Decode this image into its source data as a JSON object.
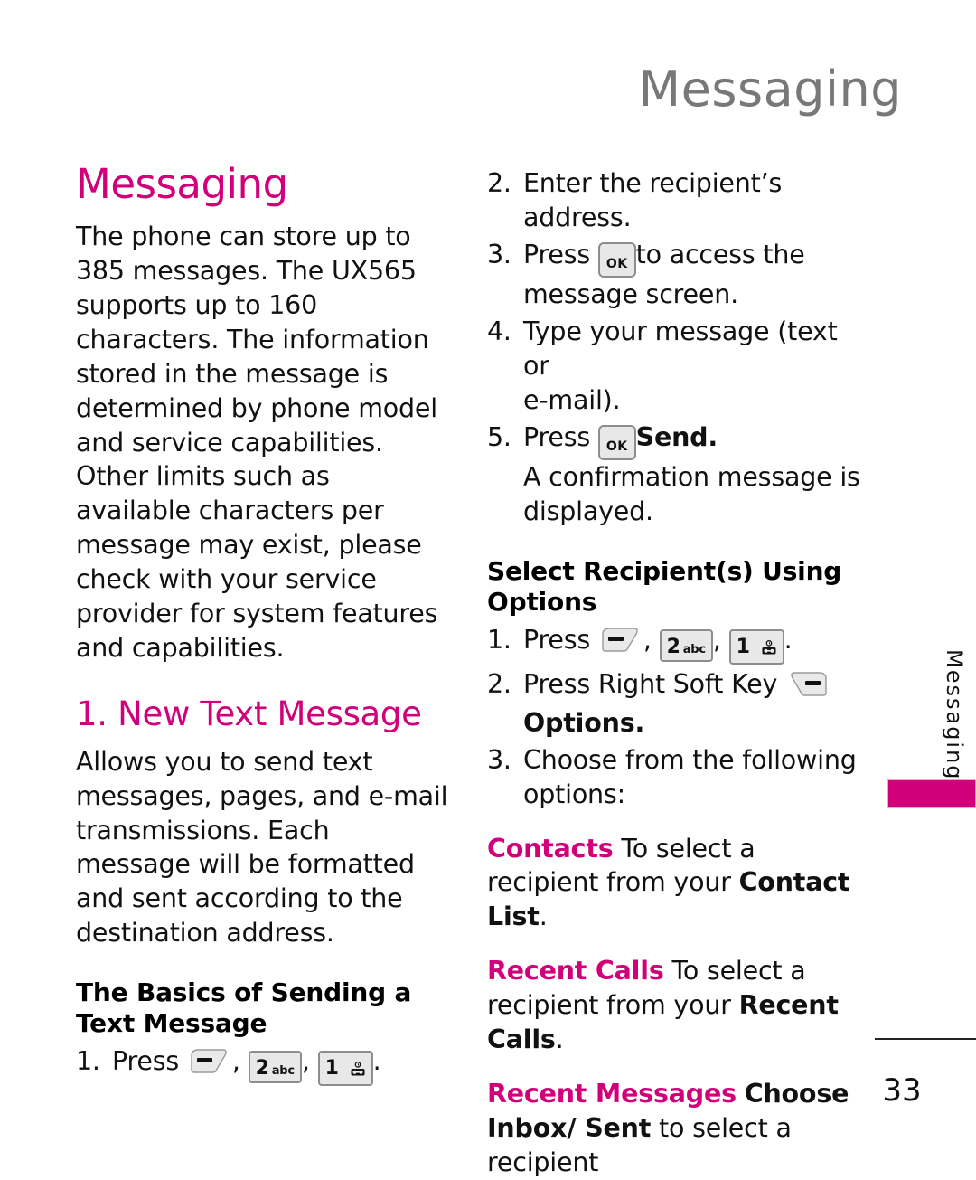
{
  "running_header": "Messaging",
  "side_tab": {
    "label": "Messaging",
    "accent_color": "#d1007a"
  },
  "footer": {
    "page_number": "33"
  },
  "colors": {
    "accent": "#d1007a",
    "header_gray": "#77787a",
    "body": "#111111"
  },
  "left_column": {
    "chapter_title": "Messaging",
    "intro_paragraph": "The phone can store up to 385 messages. The UX565 supports up to 160 characters. The information stored in the message is determined by phone model and service capabilities. Other limits such as available characters per message may exist, please check with your service provider for system features and capabilities.",
    "section_title": "1. New Text Message",
    "section_paragraph": "Allows you to send text messages, pages, and e-mail transmissions. Each message will be formatted and sent according to the destination address.",
    "sub_title": "The Basics of Sending a Text Message",
    "step1": {
      "number": "1.",
      "press_label": "Press",
      "comma1": ",",
      "comma2": ",",
      "period": "."
    }
  },
  "right_column": {
    "step2": {
      "number": "2.",
      "text": "Enter the recipient’s address."
    },
    "step3": {
      "number": "3.",
      "press_label": "Press",
      "after_key": "to access the",
      "line2": "message screen."
    },
    "step4": {
      "number": "4.",
      "text": "Type your message (text or",
      "line2": "e-mail)."
    },
    "step5": {
      "number": "5.",
      "press_label": "Press",
      "bold_after_key": "Send.",
      "line2": "A confirmation message is",
      "line3": "displayed."
    },
    "sub_title": "Select Recipient(s) Using Options",
    "opt_step1": {
      "number": "1.",
      "press_label": "Press",
      "comma1": ",",
      "comma2": ",",
      "period": "."
    },
    "opt_step2": {
      "number": "2.",
      "text": "Press Right Soft Key",
      "bold_line2": "Options."
    },
    "opt_step3": {
      "number": "3.",
      "text": "Choose from the following",
      "line2": "options:"
    },
    "options": [
      {
        "term": "Contacts",
        "desc_pre": "To select a recipient from your ",
        "desc_bold": "Contact List",
        "desc_post": "."
      },
      {
        "term": "Recent Calls",
        "desc_pre": "To select a recipient from your ",
        "desc_bold": "Recent Calls",
        "desc_post": "."
      },
      {
        "term": "Recent Messages",
        "desc_pre": "",
        "desc_bold": "Choose Inbox/ Sent",
        "desc_post": " to select a recipient"
      }
    ]
  },
  "keys": {
    "left_soft_key": "left-soft-key",
    "right_soft_key": "right-soft-key",
    "ok_key_label": "OK",
    "key2_digit": "2",
    "key2_letters": "abc",
    "key1_digit": "1",
    "key1_glyph": "voicemail"
  }
}
